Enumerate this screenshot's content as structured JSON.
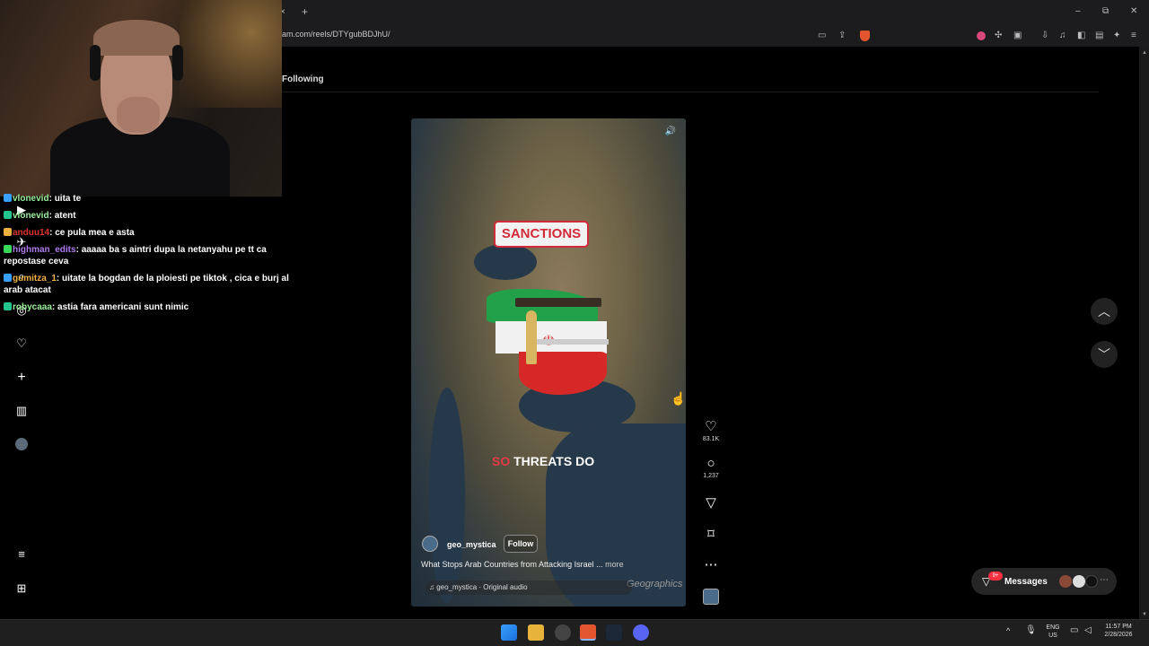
{
  "browser": {
    "url": "am.com/reels/DTYgubBDJhU/",
    "new_tab": "+",
    "tab_close": "×",
    "window_minimize": "–",
    "window_restore": "⧉",
    "window_close": "✕"
  },
  "page": {
    "tab_following": "Following"
  },
  "reel": {
    "overlay_sanctions": "SANCTIONS",
    "caption_red": "SO",
    "caption_white": " THREATS DO",
    "watermark": "Geographics",
    "username": "geo_mystica",
    "follow_label": "Follow",
    "description": "What Stops Arab Countries from Attacking Israel ...",
    "more_label": "more",
    "audio": "geo_mystica · Original audio"
  },
  "actions": {
    "likes": "83.1K",
    "comments": "1,237"
  },
  "messages": {
    "badge": "9+",
    "label": "Messages"
  },
  "chat": [
    {
      "user": "vlonevid",
      "color": "#9cf09c",
      "text": "uita te"
    },
    {
      "user": "vlonevid",
      "color": "#9cf09c",
      "text": "atent"
    },
    {
      "user": "anduu14",
      "color": "#e0342c",
      "text": "ce pula mea e asta"
    },
    {
      "user": "highman_edits",
      "color": "#b07cf0",
      "text": "aaaaa ba s aintri dupa la netanyahu pe tt ca repostase ceva"
    },
    {
      "user": "gumitza_1",
      "color": "#f0b040",
      "text": "uitate la bogdan de la ploiesti pe tiktok , cica e burj al arab atacat"
    },
    {
      "user": "robycaaa",
      "color": "#9cf09c",
      "text": "astia fara americani sunt nimic"
    }
  ],
  "tray": {
    "lang_top": "ENG",
    "lang_bottom": "US",
    "time": "11:57 PM",
    "date": "2/28/2026"
  },
  "colors": {
    "accent_red": "#d12a3a",
    "notification": "#ff3040"
  }
}
